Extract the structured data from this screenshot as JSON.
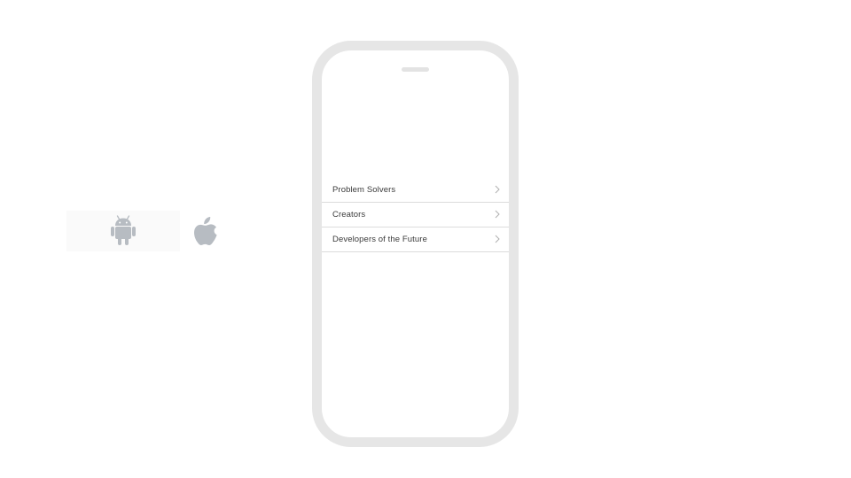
{
  "platforms": [
    {
      "name": "android",
      "icon": "android-icon",
      "selected": true
    },
    {
      "name": "ios",
      "icon": "apple-icon",
      "selected": false
    }
  ],
  "phone": {
    "menu": [
      {
        "label": "Problem Solvers"
      },
      {
        "label": "Creators"
      },
      {
        "label": "Developers of the Future"
      }
    ]
  },
  "colors": {
    "icon": "#b7bcc2",
    "phone_frame": "#e6e6e6",
    "divider": "#dcdcdc",
    "label": "#3a3a3a",
    "chevron": "#b0b0b0"
  }
}
